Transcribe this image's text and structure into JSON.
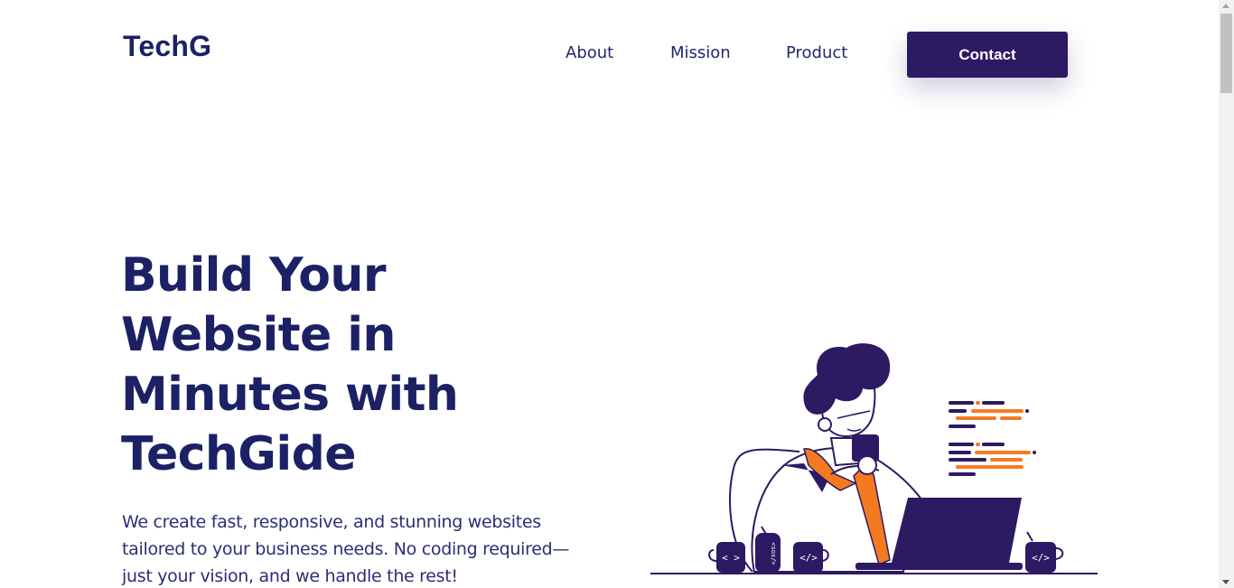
{
  "brand": {
    "logo": "TechG"
  },
  "nav": {
    "items": [
      {
        "label": "About"
      },
      {
        "label": "Mission"
      },
      {
        "label": "Product"
      }
    ],
    "contact_label": "Contact"
  },
  "hero": {
    "title": "Build Your Website in Minutes with TechGide",
    "description": "We create fast, responsive, and stunning websites tailored to your business needs. No coding required—just your vision, and we handle the rest!"
  },
  "illustration": {
    "mug_left_label": "< >",
    "can_label": "<sos/>",
    "mug_middle_label": "</>",
    "mug_right_label": "</>"
  },
  "colors": {
    "primary": "#2c1a63",
    "heading": "#1c2166",
    "accent": "#f47a22",
    "background": "#ffffff"
  }
}
